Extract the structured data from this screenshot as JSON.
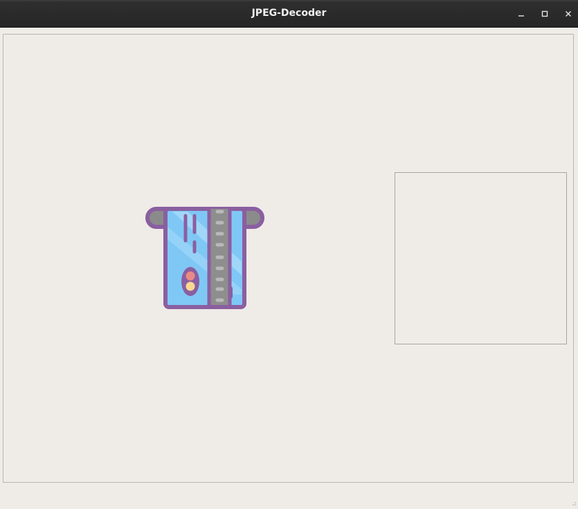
{
  "window": {
    "title": "JPEG-Decoder",
    "minimize_icon": "minimize-icon",
    "maximize_icon": "maximize-icon",
    "close_icon": "close-icon"
  },
  "main": {
    "image": {
      "icon": "atm-card-slot-icon",
      "colors": {
        "outline": "#8a5fa0",
        "slot": "#8b8b8b",
        "card": "#7fc8f6",
        "card_highlight": "#a9dbfa",
        "stripe": "#8e8e8e",
        "dots": "#b9b9b9",
        "chip_top": "#e98a86",
        "chip_bottom": "#f8d891"
      }
    }
  }
}
